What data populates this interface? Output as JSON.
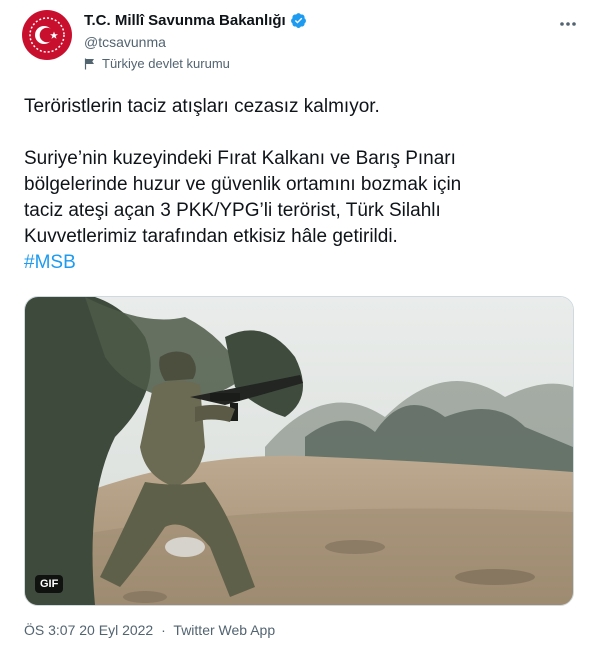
{
  "account": {
    "display_name": "T.C. Millî Savunma Bakanlığı",
    "handle": "@tcsavunma",
    "affiliation": "Türkiye devlet kurumu",
    "verified_icon": "verified-badge-icon",
    "avatar_icon": "crescent-star-emblem"
  },
  "tweet": {
    "line1": "Teröristlerin taciz atışları cezasız kalmıyor.",
    "para2_l1": "Suriye’nin kuzeyindeki Fırat Kalkanı ve Barış Pınarı",
    "para2_l2": "bölgelerinde huzur ve güvenlik ortamını bozmak için",
    "para2_l3": "taciz ateşi açan 3 PKK/YPG’li terörist, Türk Silahlı",
    "para2_l4": "Kuvvetlerimiz tarafından etkisiz hâle getirildi.",
    "hashtag": "#MSB"
  },
  "media": {
    "badge": "GIF"
  },
  "meta": {
    "time": "ÖS 3:07",
    "date": "20 Eyl 2022",
    "dot": "·",
    "source": "Twitter Web App"
  },
  "colors": {
    "accent": "#1d9bf0",
    "brand_red": "#c8102e",
    "secondary_text": "#536471"
  }
}
